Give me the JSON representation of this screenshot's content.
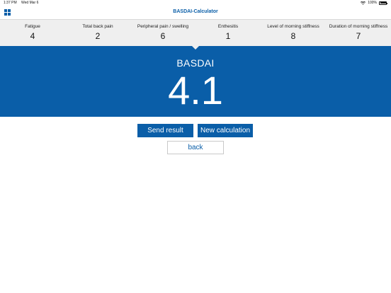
{
  "status_bar": {
    "time": "1:37 PM",
    "date": "Wed Mar 6",
    "battery": "100%",
    "battery_level": 1.0
  },
  "nav": {
    "title": "BASDAI-Calculator"
  },
  "scores": [
    {
      "label": "Fatigue",
      "value": "4"
    },
    {
      "label": "Total back pain",
      "value": "2"
    },
    {
      "label": "Peripheral pain / swelling",
      "value": "6"
    },
    {
      "label": "Enthesitis",
      "value": "1"
    },
    {
      "label": "Level of morning stiffness",
      "value": "8"
    },
    {
      "label": "Duration of morning stiffness",
      "value": "7"
    }
  ],
  "result": {
    "label": "BASDAI",
    "value": "4.1"
  },
  "actions": {
    "send_label": "Send result",
    "new_label": "New calculation",
    "back_label": "back"
  },
  "colors": {
    "accent": "#0a5ea8",
    "panel": "#efefef"
  }
}
